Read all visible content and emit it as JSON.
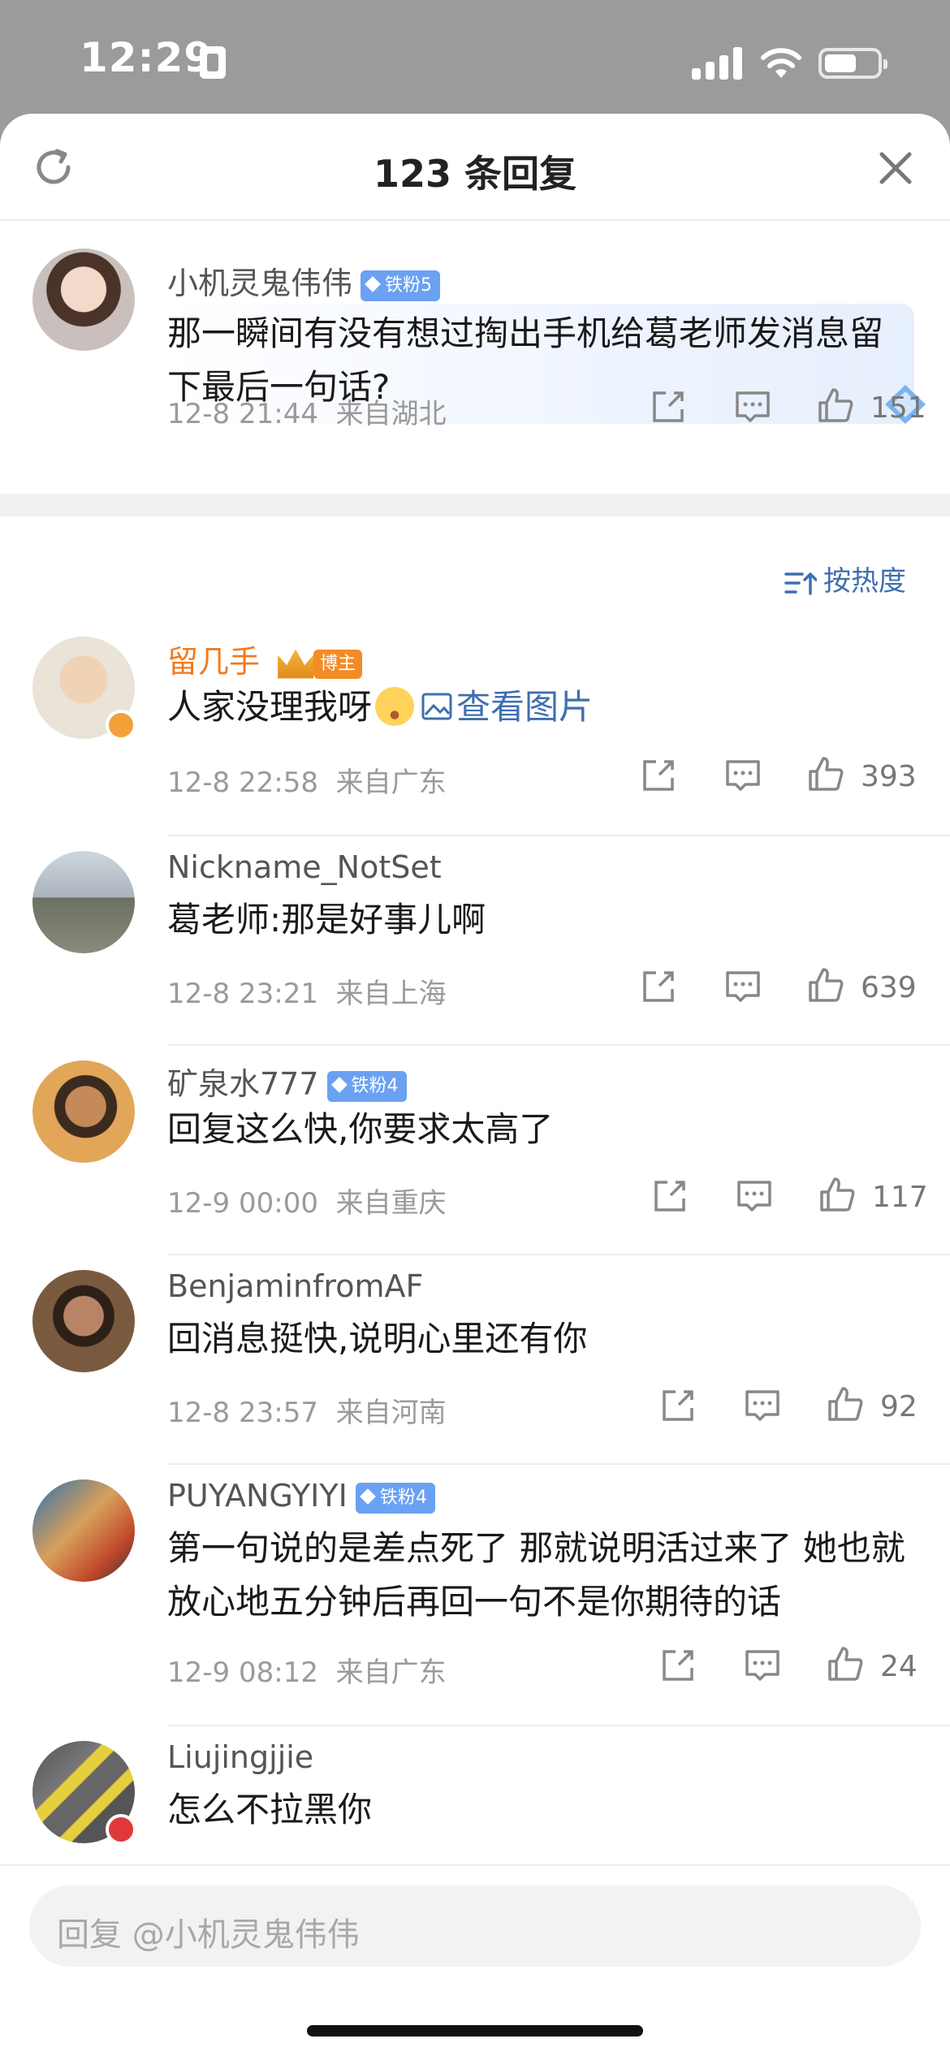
{
  "status_bar": {
    "time": "12:29"
  },
  "sheet": {
    "title": "123 条回复",
    "main_comment": {
      "username": "小机灵鬼伟伟",
      "fan_badge": "铁粉5",
      "content": "那一瞬间有没有想过掏出手机给葛老师发消息留下最后一句话?",
      "time": "12-8 21:44",
      "location": "来自湖北",
      "likes": "151"
    },
    "sort_label": "按热度",
    "replies": [
      {
        "username": "留几手",
        "role_badge": "博主",
        "content": "人家没理我呀",
        "link_text": "查看图片",
        "time": "12-8 22:58",
        "location": "来自广东",
        "likes": "393"
      },
      {
        "username": "Nickname_NotSet",
        "content": "葛老师:那是好事儿啊",
        "time": "12-8 23:21",
        "location": "来自上海",
        "likes": "639"
      },
      {
        "username": "矿泉水777",
        "fan_badge": "铁粉4",
        "content": "回复这么快,你要求太高了",
        "time": "12-9 00:00",
        "location": "来自重庆",
        "likes": "117"
      },
      {
        "username": "BenjaminfromAF",
        "content": "回消息挺快,说明心里还有你",
        "time": "12-8 23:57",
        "location": "来自河南",
        "likes": "92"
      },
      {
        "username": "PUYANGYIYI",
        "fan_badge": "铁粉4",
        "content": "第一句说的是差点死了 那就说明活过来了 她也就放心地五分钟后再回一句不是你期待的话",
        "time": "12-9 08:12",
        "location": "来自广东",
        "likes": "24"
      },
      {
        "username": "Liujingjjie",
        "content": "怎么不拉黑你"
      }
    ],
    "input_placeholder": "回复 @小机灵鬼伟伟"
  },
  "colors": {
    "accent_blue": "#3f6fb0",
    "blogger_orange": "#f37a1f",
    "fan_badge_blue": "#6aa1f2"
  }
}
